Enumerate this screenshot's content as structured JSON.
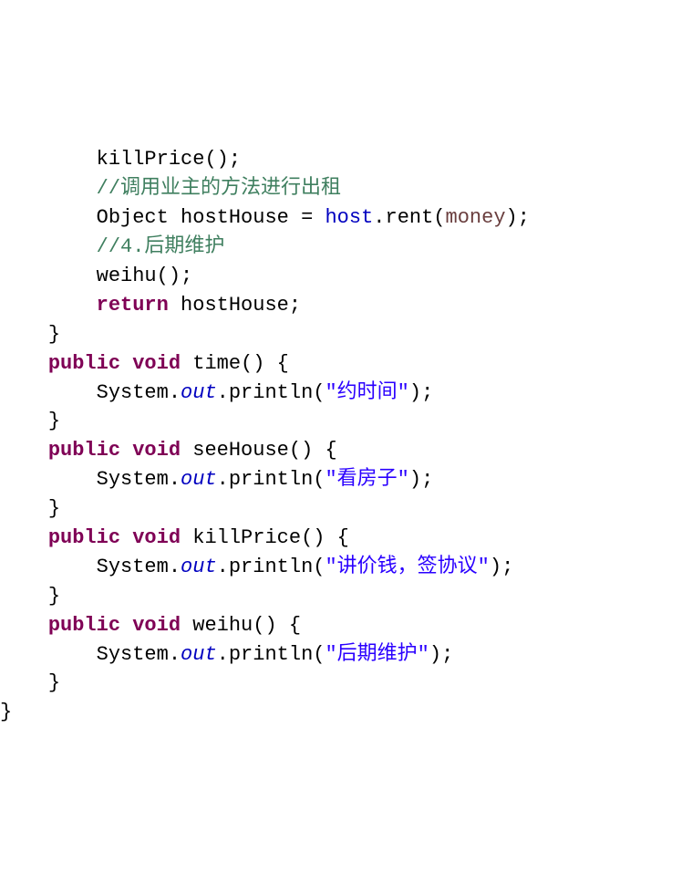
{
  "code": {
    "line1_call": "killPrice();",
    "line2_comment": "//调用业主的方法进行出租",
    "line3_type": "Object",
    "line3_var": " hostHouse = ",
    "line3_host": "host",
    "line3_rest": ".rent(",
    "line3_money": "money",
    "line3_end": ");",
    "line4_comment": "//4.后期维护",
    "line5_call": "weihu();",
    "line6_kw": "return",
    "line6_rest": " hostHouse;",
    "line7_brace": "}",
    "line8_kw1": "public",
    "line8_kw2": "void",
    "line8_sig": " time() {",
    "line9_sys": "System.",
    "line9_out": "out",
    "line9_print": ".println(",
    "line9_str": "\"约时间\"",
    "line9_end": ");",
    "line10_brace": "}",
    "line11_kw1": "public",
    "line11_kw2": "void",
    "line11_sig": " seeHouse() {",
    "line12_sys": "System.",
    "line12_out": "out",
    "line12_print": ".println(",
    "line12_str": "\"看房子\"",
    "line12_end": ");",
    "line13_brace": "}",
    "line14_kw1": "public",
    "line14_kw2": "void",
    "line14_sig": " killPrice() {",
    "line15_sys": "System.",
    "line15_out": "out",
    "line15_print": ".println(",
    "line15_str": "\"讲价钱，签协议\"",
    "line15_end": ");",
    "line16_brace": "}",
    "line17_kw1": "public",
    "line17_kw2": "void",
    "line17_sig": " weihu() {",
    "line18_sys": "System.",
    "line18_out": "out",
    "line18_print": ".println(",
    "line18_str": "\"后期维护\"",
    "line18_end": ");",
    "line19_brace": "}",
    "line20_brace": "}"
  }
}
